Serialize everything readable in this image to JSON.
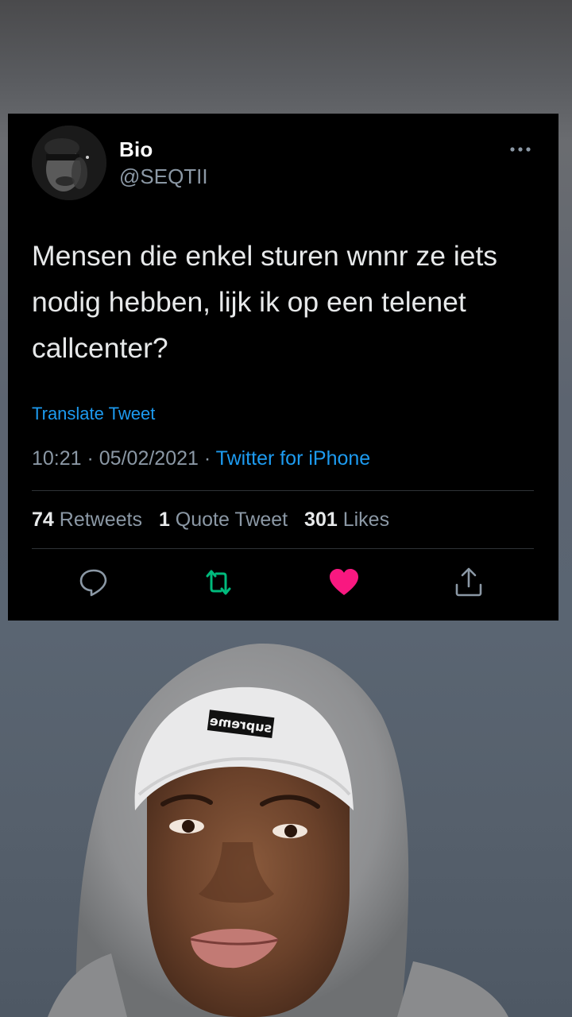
{
  "tweet": {
    "display_name": "Bio",
    "handle": "@SEQTII",
    "text": "Mensen die enkel sturen wnnr ze iets nodig hebben, lijk ik op een telenet callcenter?",
    "translate_label": "Translate Tweet",
    "time": "10:21",
    "separator": " · ",
    "date": "05/02/2021",
    "source": "Twitter for iPhone",
    "stats": {
      "retweets_count": "74",
      "retweets_label": "Retweets",
      "quotes_count": "1",
      "quotes_label": "Quote Tweet",
      "likes_count": "301",
      "likes_label": "Likes"
    },
    "actions": {
      "reply_icon": "reply-bubble-icon",
      "retweet_icon": "retweet-icon",
      "like_icon": "heart-filled-icon",
      "share_icon": "share-icon"
    },
    "more_icon": "more-dots-icon"
  },
  "colors": {
    "background": "#000000",
    "primary_text": "#e7e9ea",
    "secondary_text": "#8b98a5",
    "link": "#1d9bf0",
    "retweet_active": "#00ba7c",
    "like_active": "#f91880"
  },
  "photo": {
    "description_icon": "selfie-photo",
    "beanie_text": "supreme"
  }
}
